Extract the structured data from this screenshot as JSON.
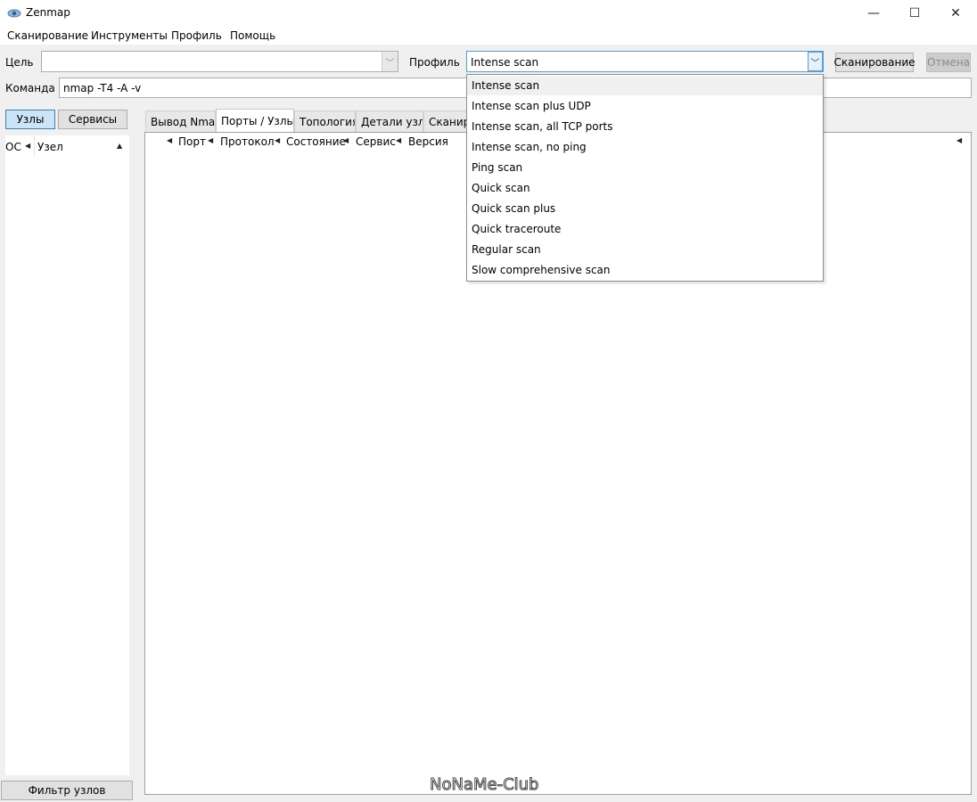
{
  "window": {
    "title": "Zenmap",
    "minimize": "—",
    "maximize": "☐",
    "close": "✕"
  },
  "menu": [
    "Сканирование",
    "Инструменты",
    "Профиль",
    "Помощь"
  ],
  "toolbar": {
    "target_label": "Цель",
    "target_value": "",
    "profile_label": "Профиль",
    "profile_value": "Intense scan",
    "scan_button": "Сканирование",
    "cancel_button": "Отмена",
    "command_label": "Команда",
    "command_value": "nmap -T4 -A -v"
  },
  "left": {
    "hosts_button": "Узлы",
    "services_button": "Сервисы",
    "col_os": "ОС",
    "col_host": "Узел",
    "filter_button": "Фильтр узлов"
  },
  "tabs": [
    "Вывод Nmap",
    "Порты / Узлы",
    "Топология",
    "Детали узла",
    "Сканир"
  ],
  "ports_table": {
    "columns": [
      "Порт",
      "Протокол",
      "Состояние",
      "Сервис",
      "Версия"
    ]
  },
  "profile_dropdown": {
    "options": [
      "Intense scan",
      "Intense scan plus UDP",
      "Intense scan, all TCP ports",
      "Intense scan, no ping",
      "Ping scan",
      "Quick scan",
      "Quick scan plus",
      "Quick traceroute",
      "Regular scan",
      "Slow comprehensive scan"
    ],
    "highlighted": "Intense scan"
  },
  "watermark": "NoNaMe-Club"
}
